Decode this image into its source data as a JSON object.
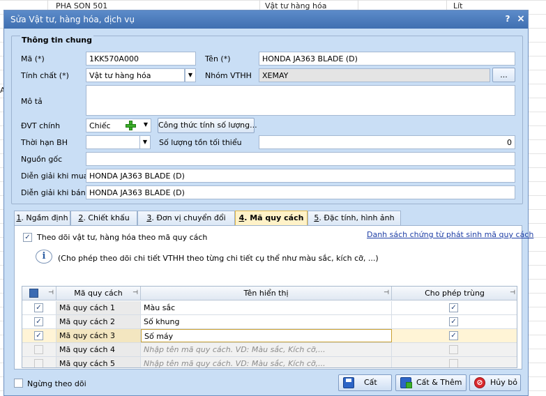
{
  "background": {
    "row1_col1": "PHA SON 501",
    "row1_col2": "Vật tư hàng hóa",
    "row1_col3": "Lít",
    "left_fragment": "AM"
  },
  "dialog": {
    "title": "Sửa Vật tư, hàng hóa, dịch vụ",
    "help_glyph": "?",
    "close_glyph": "×"
  },
  "general": {
    "group_title": "Thông tin chung",
    "code_label": "Mã (*)",
    "code_value": "1KK570A000",
    "name_label": "Tên (*)",
    "name_value": "HONDA JA363 BLADE (D)",
    "nature_label": "Tính chất (*)",
    "nature_value": "Vật tư hàng hóa",
    "group_label": "Nhóm VTHH",
    "group_value": "XEMAY",
    "group_btn": "...",
    "desc_label": "Mô tả",
    "desc_value": "",
    "unit_label": "ĐVT chính",
    "unit_value": "Chiếc",
    "formula_btn": "Công thức tính số lượng...",
    "warranty_label": "Thời hạn BH",
    "warranty_value": "",
    "minstock_label": "Số lượng tồn tối thiểu",
    "minstock_value": "0",
    "origin_label": "Nguồn gốc",
    "origin_value": "",
    "buy_desc_label": "Diễn giải khi mua",
    "buy_desc_value": "HONDA JA363 BLADE (D)",
    "sell_desc_label": "Diễn giải khi bán",
    "sell_desc_value": "HONDA JA363 BLADE (D)"
  },
  "tabs": [
    {
      "num": "1",
      "label": ". Ngầm định"
    },
    {
      "num": "2",
      "label": ". Chiết khấu"
    },
    {
      "num": "3",
      "label": ". Đơn vị chuyển đổi"
    },
    {
      "num": "4",
      "label": ". Mã quy cách"
    },
    {
      "num": "5",
      "label": ". Đặc tính, hình ảnh"
    }
  ],
  "spec": {
    "track_label": "Theo dõi vật tư, hàng hóa theo mã quy cách",
    "track_checked": true,
    "doc_link": "Danh sách chứng từ phát sinh mã quy cách",
    "info_text": "(Cho phép theo dõi chi tiết VTHH theo từng chi tiết cụ thể như màu sắc, kích cỡ, ...)",
    "columns": {
      "code": "Mã quy cách",
      "display": "Tên hiển thị",
      "dup": "Cho phép trùng"
    },
    "rows": [
      {
        "checked": true,
        "code": "Mã quy cách 1",
        "display": "Màu sắc",
        "placeholder": false,
        "dup": true
      },
      {
        "checked": true,
        "code": "Mã quy cách 2",
        "display": "Số khung",
        "placeholder": false,
        "dup": true
      },
      {
        "checked": true,
        "code": "Mã quy cách 3",
        "display": "Số máy",
        "placeholder": false,
        "dup": true
      },
      {
        "checked": false,
        "code": "Mã quy cách 4",
        "display": "Nhập tên mã quy cách. VD: Màu sắc, Kích cỡ,...",
        "placeholder": true,
        "dup": false
      },
      {
        "checked": false,
        "code": "Mã quy cách 5",
        "display": "Nhập tên mã quy cách. VD: Màu sắc, Kích cỡ,...",
        "placeholder": true,
        "dup": false
      }
    ]
  },
  "footer": {
    "stop_label": "Ngừng theo dõi",
    "save": "Cất",
    "save_add": "Cất & Thêm",
    "cancel": "Hủy bỏ"
  },
  "colors": {
    "title": "#4a7abd",
    "active_tab": "#fff2c8",
    "selected_row": "#fff4d6",
    "dialog_bg": "#c9def5",
    "link": "#1f3fa6"
  }
}
